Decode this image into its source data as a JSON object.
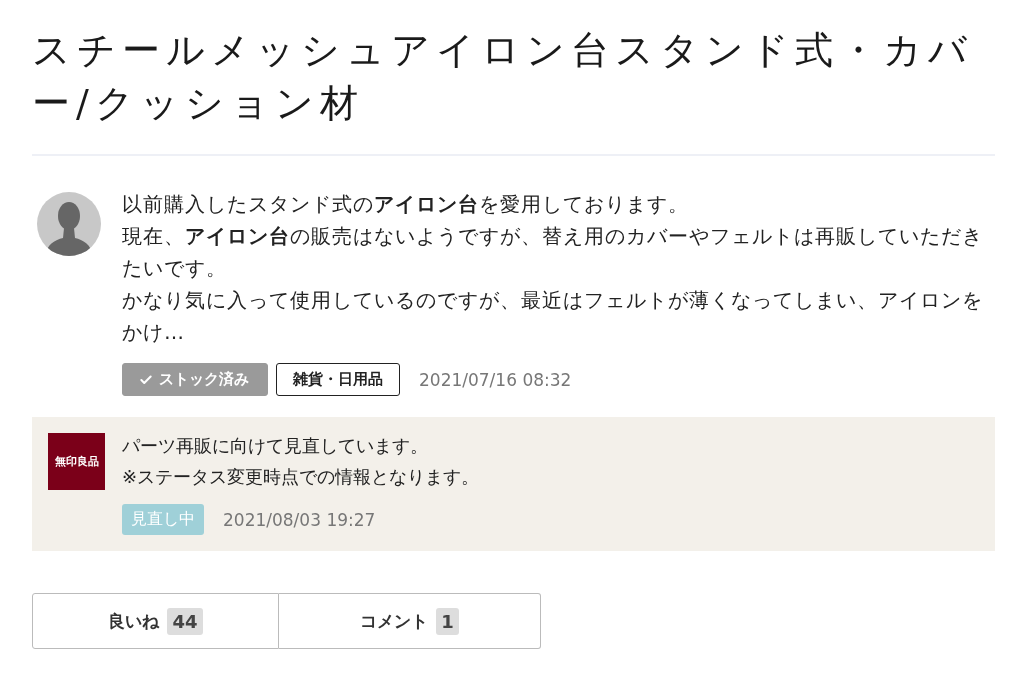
{
  "title": "スチールメッシュアイロン台スタンド式・カバー/クッション材",
  "post": {
    "body": [
      "以前購入したスタンド式の**アイロン台**を愛用しております。",
      "現在、**アイロン台**の販売はないようですが、替え用のカバーやフェルトは再販していただきたいです。",
      "かなり気に入って使用しているのですが、最近はフェルトが薄くなってしまい、アイロンをかけ…"
    ],
    "stock_button": {
      "label": "ストック済み",
      "stocked": true
    },
    "category": "雑貨・日用品",
    "date": "2021/07/16 08:32"
  },
  "reply": {
    "logo": "無印良品",
    "body": [
      "パーツ再販に向けて見直しています。",
      "※ステータス変更時点での情報となります。"
    ],
    "status": "見直し中",
    "date": "2021/08/03 19:27"
  },
  "actions": [
    {
      "label": "良いね",
      "count": "44"
    },
    {
      "label": "コメント",
      "count": "1"
    }
  ]
}
